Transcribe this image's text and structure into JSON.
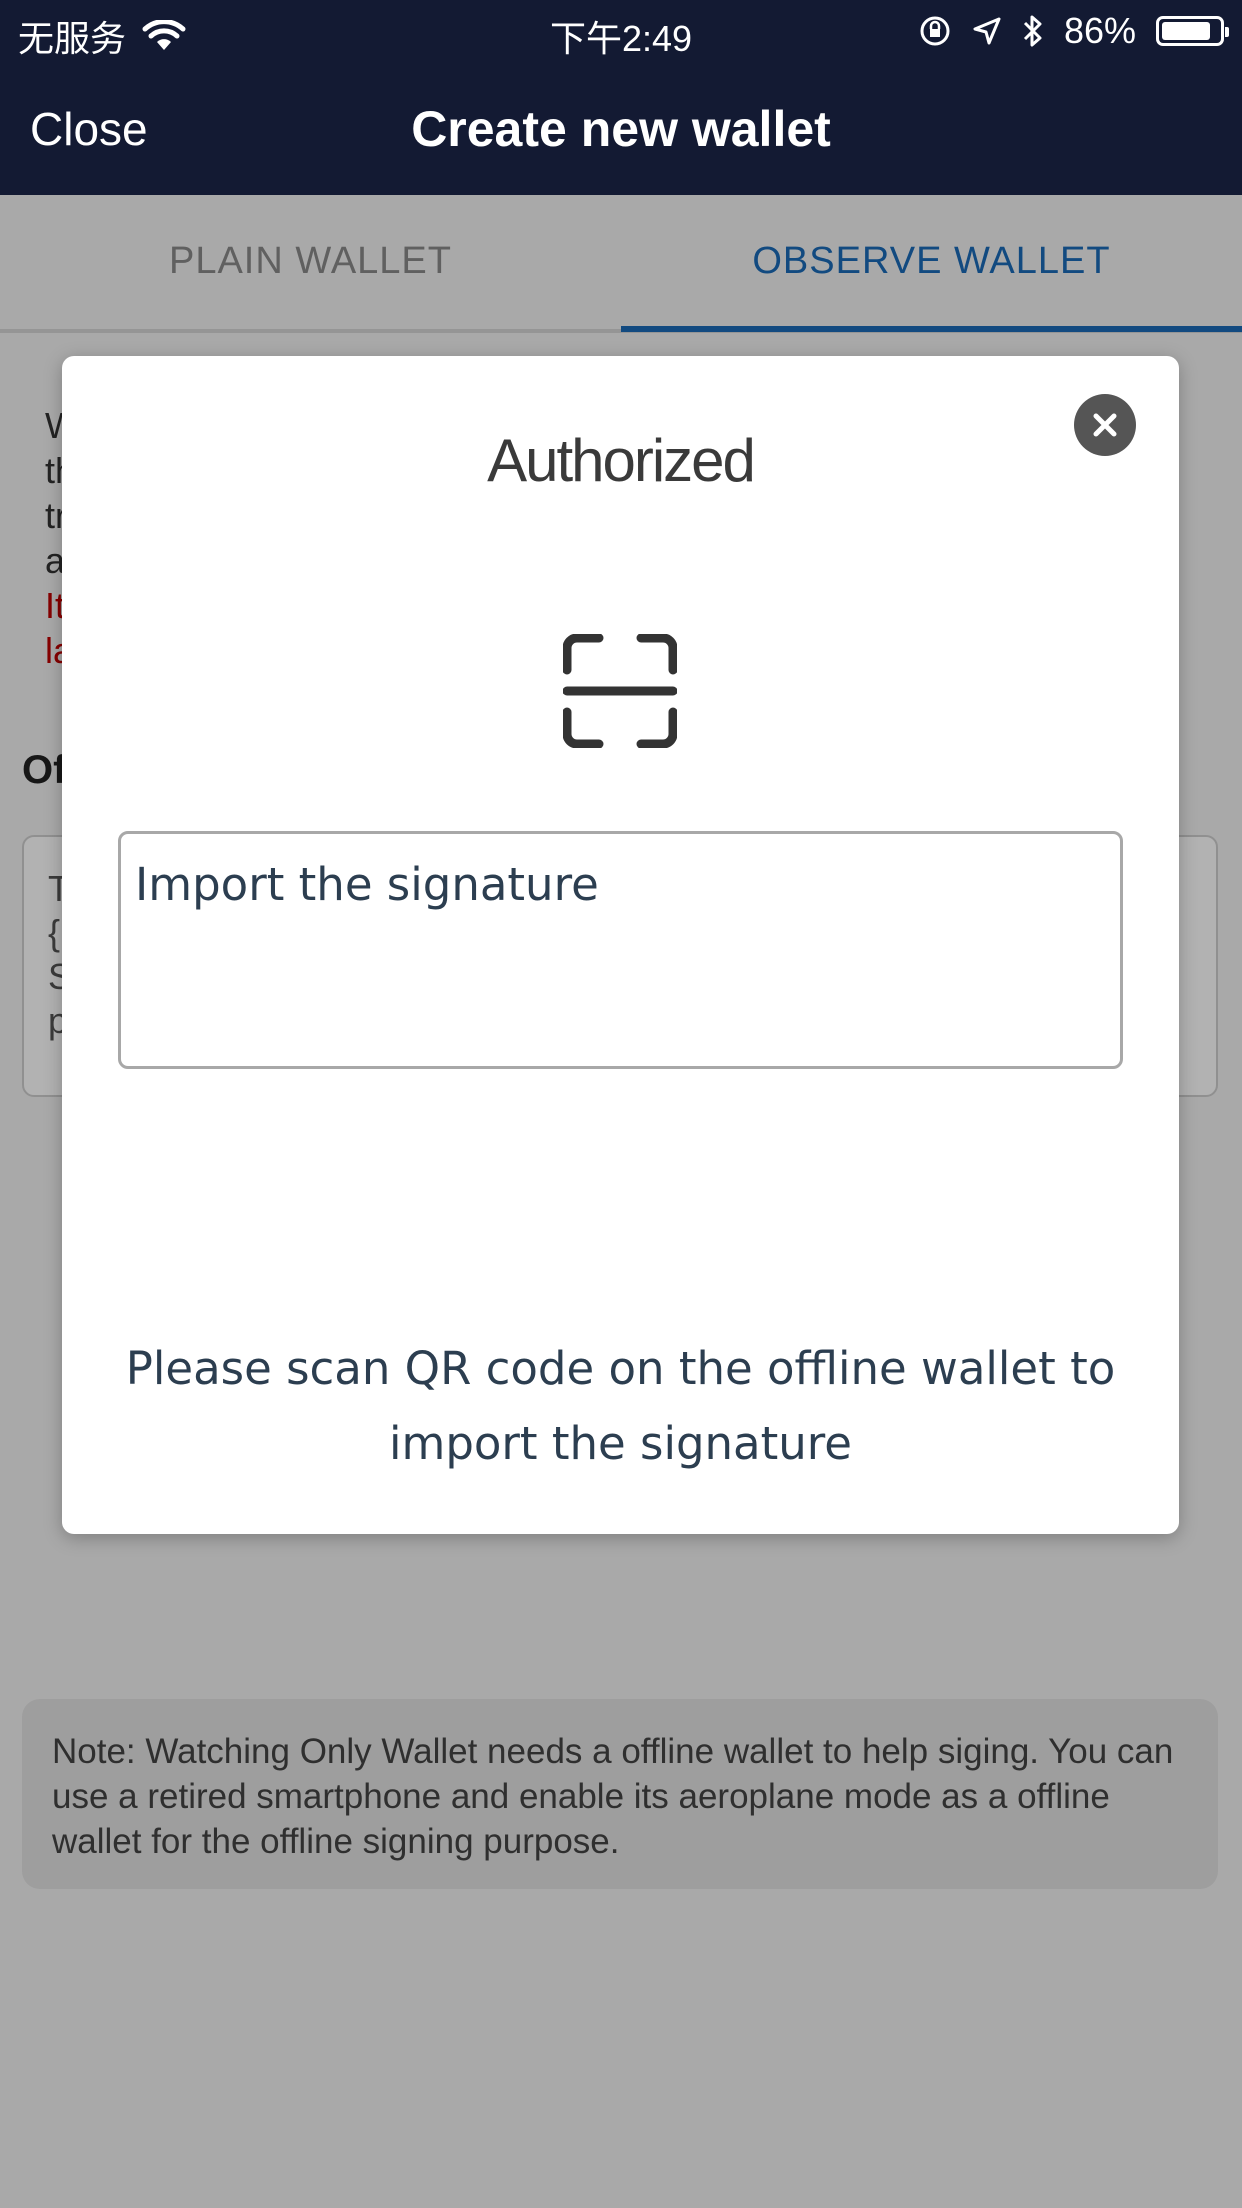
{
  "status_bar": {
    "carrier": "无服务",
    "time": "下午2:49",
    "battery_percent": "86%",
    "battery_level": 0.86
  },
  "nav": {
    "close_label": "Close",
    "title": "Create new wallet"
  },
  "tabs": [
    {
      "label": "PLAIN WALLET",
      "active": false
    },
    {
      "label": "OBSERVE WALLET",
      "active": true
    }
  ],
  "background": {
    "desc_lines": [
      "W",
      "th",
      "tr",
      "a"
    ],
    "desc_red_lines": [
      "It",
      "la"
    ],
    "offline_title": "Of",
    "textarea_lines": [
      "T",
      "{",
      "S",
      "p"
    ],
    "note": "Note: Watching Only Wallet needs a offline wallet to help siging. You can use a retired smartphone and enable its aeroplane mode as a offline wallet for the offline signing purpose."
  },
  "modal": {
    "title": "Authorized",
    "close_icon": "close-icon",
    "scan_icon": "scan-icon",
    "signature_placeholder": "Import the signature",
    "message": "Please scan QR code on the offline wallet to import the signature"
  },
  "colors": {
    "nav_bg": "#131a33",
    "accent": "#1a6bb8",
    "warning_red": "#c00000",
    "text_dark": "#2c3e50"
  }
}
